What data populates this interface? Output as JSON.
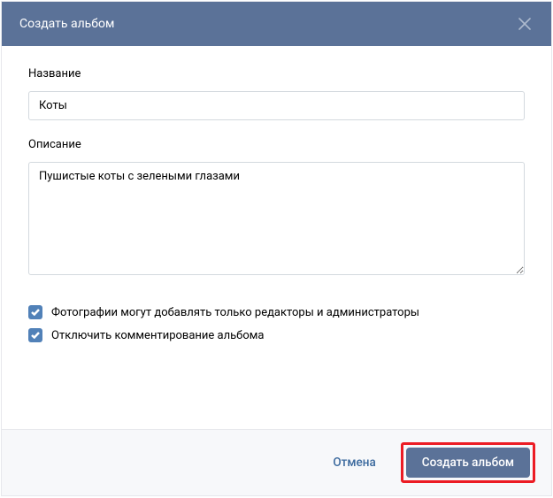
{
  "header": {
    "title": "Создать альбом"
  },
  "form": {
    "name_label": "Название",
    "name_value": "Коты",
    "desc_label": "Описание",
    "desc_value": "Пушистые коты с зелеными глазами",
    "checkbox1_label": "Фотографии могут добавлять только редакторы и администраторы",
    "checkbox2_label": "Отключить комментирование альбома"
  },
  "footer": {
    "cancel": "Отмена",
    "submit": "Создать альбом"
  }
}
